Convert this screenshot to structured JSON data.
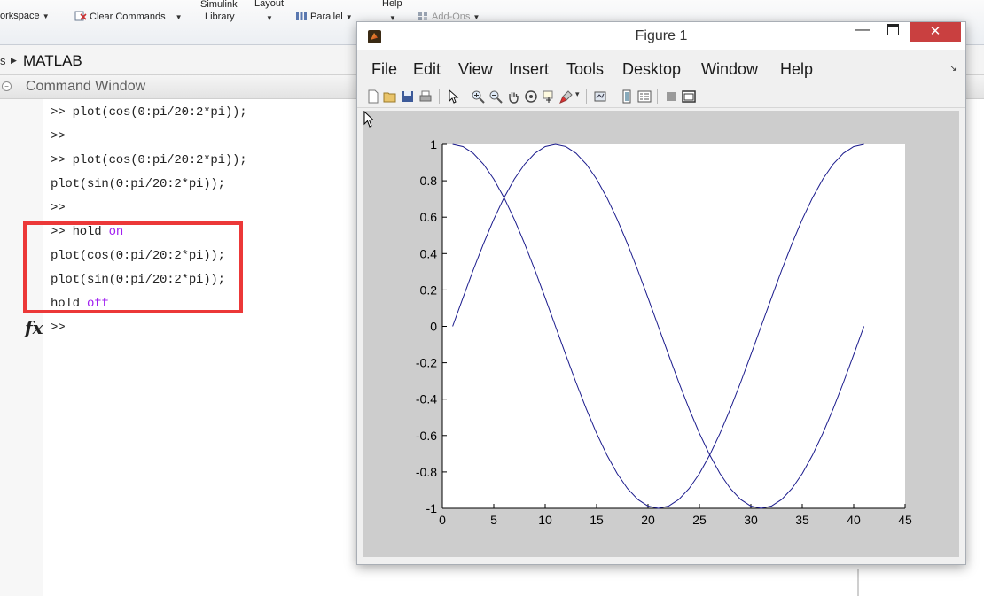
{
  "toolstrip": {
    "workspace_label": "orkspace",
    "clear_commands_label": "Clear Commands",
    "simulink_label": "Simulink",
    "library_label": "Library",
    "layout_label": "Layout",
    "parallel_label": "Parallel",
    "help_label": "Help",
    "addons_label": "Add-Ons"
  },
  "address": {
    "path": "MATLAB"
  },
  "command_window": {
    "title": "Command Window",
    "lines": [
      {
        "pre": ">> plot(cos(0:pi/20:2*pi));",
        "kw": ""
      },
      {
        "pre": ">>",
        "kw": ""
      },
      {
        "pre": ">> plot(cos(0:pi/20:2*pi));",
        "kw": ""
      },
      {
        "pre": "plot(sin(0:pi/20:2*pi));",
        "kw": ""
      },
      {
        "pre": ">>",
        "kw": ""
      },
      {
        "pre": ">> hold ",
        "kw": "on"
      },
      {
        "pre": "plot(cos(0:pi/20:2*pi));",
        "kw": ""
      },
      {
        "pre": "plot(sin(0:pi/20:2*pi));",
        "kw": ""
      },
      {
        "pre": "hold ",
        "kw": "off"
      }
    ],
    "prompt": ">>",
    "fx_label": "fx"
  },
  "figure": {
    "title": "Figure 1",
    "menu": [
      "File",
      "Edit",
      "View",
      "Insert",
      "Tools",
      "Desktop",
      "Window",
      "Help"
    ],
    "toolbar_icons": [
      "new-figure-icon",
      "open-file-icon",
      "save-icon",
      "print-icon",
      "edit-plot-icon",
      "zoom-in-icon",
      "zoom-out-icon",
      "pan-icon",
      "rotate-3d-icon",
      "data-cursor-icon",
      "brush-icon",
      "link-plot-icon",
      "colorbar-icon",
      "legend-icon",
      "hide-plot-tools-icon",
      "show-plot-tools-icon"
    ],
    "colors": {
      "line": "#1a1a8c",
      "close_button": "#c94040",
      "highlight": "#ec3838"
    }
  },
  "chart_data": {
    "type": "line",
    "title": "",
    "xlabel": "",
    "ylabel": "",
    "xlim": [
      0,
      45
    ],
    "ylim": [
      -1,
      1
    ],
    "xticks": [
      0,
      5,
      10,
      15,
      20,
      25,
      30,
      35,
      40,
      45
    ],
    "yticks": [
      -1,
      -0.8,
      -0.6,
      -0.4,
      -0.2,
      0,
      0.2,
      0.4,
      0.6,
      0.8,
      1
    ],
    "ytick_labels": [
      "-1",
      "-0.8",
      "-0.6",
      "-0.4",
      "-0.2",
      "0",
      "0.2",
      "0.4",
      "0.6",
      "0.8",
      "1"
    ],
    "grid": false,
    "series": [
      {
        "x": [
          1,
          2,
          3,
          4,
          5,
          6,
          7,
          8,
          9,
          10,
          11,
          12,
          13,
          14,
          15,
          16,
          17,
          18,
          19,
          20,
          21,
          22,
          23,
          24,
          25,
          26,
          27,
          28,
          29,
          30,
          31,
          32,
          33,
          34,
          35,
          36,
          37,
          38,
          39,
          40,
          41
        ],
        "y": [
          1,
          0.988,
          0.951,
          0.891,
          0.809,
          0.707,
          0.588,
          0.454,
          0.309,
          0.156,
          0,
          -0.156,
          -0.309,
          -0.454,
          -0.588,
          -0.707,
          -0.809,
          -0.891,
          -0.951,
          -0.988,
          -1,
          -0.988,
          -0.951,
          -0.891,
          -0.809,
          -0.707,
          -0.588,
          -0.454,
          -0.309,
          -0.156,
          0,
          0.156,
          0.309,
          0.454,
          0.588,
          0.707,
          0.809,
          0.891,
          0.951,
          0.988,
          1
        ]
      },
      {
        "x": [
          1,
          2,
          3,
          4,
          5,
          6,
          7,
          8,
          9,
          10,
          11,
          12,
          13,
          14,
          15,
          16,
          17,
          18,
          19,
          20,
          21,
          22,
          23,
          24,
          25,
          26,
          27,
          28,
          29,
          30,
          31,
          32,
          33,
          34,
          35,
          36,
          37,
          38,
          39,
          40,
          41
        ],
        "y": [
          0,
          0.156,
          0.309,
          0.454,
          0.588,
          0.707,
          0.809,
          0.891,
          0.951,
          0.988,
          1,
          0.988,
          0.951,
          0.891,
          0.809,
          0.707,
          0.588,
          0.454,
          0.309,
          0.156,
          0,
          -0.156,
          -0.309,
          -0.454,
          -0.588,
          -0.707,
          -0.809,
          -0.891,
          -0.951,
          -0.988,
          -1,
          -0.988,
          -0.951,
          -0.891,
          -0.809,
          -0.707,
          -0.588,
          -0.454,
          -0.309,
          -0.156,
          0
        ]
      }
    ]
  }
}
